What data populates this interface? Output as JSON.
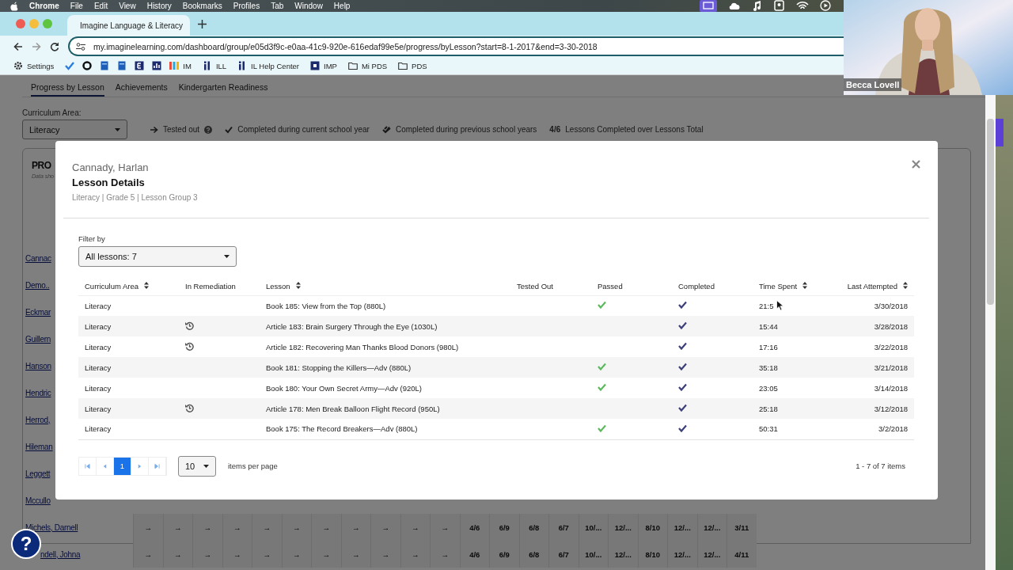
{
  "menu_bar": {
    "app": "Chrome",
    "items": [
      "File",
      "Edit",
      "View",
      "History",
      "Bookmarks",
      "Profiles",
      "Tab",
      "Window",
      "Help"
    ],
    "status_icons": [
      {
        "kind": "screen"
      },
      {
        "kind": "cloud"
      },
      {
        "kind": "music"
      },
      {
        "kind": "badge"
      },
      {
        "kind": "signal"
      },
      {
        "kind": "play"
      }
    ]
  },
  "browser": {
    "tab": {
      "title": "Imagine Language & Literacy",
      "selected": true
    },
    "url": "my.imaginelearning.com/dashboard/group/e05d3f9c-e0aa-41c9-920e-616edaf99e5e/progress/byLesson?start=8-1-2017&end=3-30-2018",
    "bookmarks": [
      {
        "kind": "gear",
        "label": "Settings"
      },
      {
        "kind": "check"
      },
      {
        "kind": "ring"
      },
      {
        "kind": "doc"
      },
      {
        "kind": "doc"
      },
      {
        "kind": "ebox"
      },
      {
        "kind": "chart"
      },
      {
        "kind": "bars",
        "label": "IM"
      },
      {
        "kind": "il",
        "label": "ILL"
      },
      {
        "kind": "il",
        "label": "IL Help Center"
      },
      {
        "kind": "square",
        "label": "IMP"
      },
      {
        "kind": "folder",
        "label": "Mi PDS"
      },
      {
        "kind": "folder",
        "label": "PDS"
      }
    ]
  },
  "video": {
    "name": "Becca Lovell"
  },
  "page": {
    "tabs": [
      {
        "label": "Progress by Lesson",
        "selected": true
      },
      {
        "label": "Achievements",
        "selected": false
      },
      {
        "label": "Kindergarten Readiness",
        "selected": false
      }
    ],
    "curriculum": {
      "label": "Curriculum Area:",
      "value": "Literacy"
    },
    "legend": [
      {
        "kind": "arrow",
        "label": "Tested out"
      },
      {
        "kind": "check",
        "label": "Completed during current school year"
      },
      {
        "kind": "double-check",
        "label": "Completed during previous school years"
      },
      {
        "kind": "ratio",
        "key": "4/6",
        "label": "Lessons Completed over Lessons Total"
      }
    ],
    "panel": {
      "title": "PRO",
      "subtitle": "Data sho"
    },
    "students": [
      {
        "name": "Cannac"
      },
      {
        "name": "Demo.."
      },
      {
        "name": "Eckmar"
      },
      {
        "name": "Guillern"
      },
      {
        "name": "Hanson"
      },
      {
        "name": "Hendric"
      },
      {
        "name": "Herrod,"
      },
      {
        "name": "Hileman"
      },
      {
        "name": "Leggett"
      },
      {
        "name": "Mccullo"
      },
      {
        "name": "Michels, Darnell",
        "cells": [
          "→",
          "→",
          "→",
          "→",
          "→",
          "→",
          "→",
          "→",
          "→",
          "→",
          "→",
          "4/6",
          "6/9",
          "6/8",
          "6/7",
          "10/...",
          "12/...",
          "8/10",
          "12/...",
          "12/...",
          "3/11"
        ]
      },
      {
        "name": "ndell, Johna",
        "cells": [
          "→",
          "→",
          "→",
          "→",
          "→",
          "→",
          "→",
          "→",
          "→",
          "→",
          "→",
          "4/6",
          "6/9",
          "6/8",
          "6/7",
          "10/...",
          "12/...",
          "8/10",
          "12/...",
          "12/...",
          "4/11"
        ]
      }
    ]
  },
  "modal": {
    "student": "Cannady, Harlan",
    "title": "Lesson Details",
    "subtitle": "Literacy | Grade 5 | Lesson Group 3",
    "filter": {
      "label": "Filter by",
      "value": "All lessons: 7"
    },
    "columns": [
      {
        "label": "Curriculum Area",
        "sortable": true
      },
      {
        "label": "In Remediation",
        "sortable": false
      },
      {
        "label": "Lesson",
        "sortable": true
      },
      {
        "label": "Tested Out",
        "sortable": false
      },
      {
        "label": "Passed",
        "sortable": false
      },
      {
        "label": "Completed",
        "sortable": false
      },
      {
        "label": "Time Spent",
        "sortable": true
      },
      {
        "label": "Last Attempted",
        "sortable": true
      }
    ],
    "rows": [
      {
        "curriculum_area": "Literacy",
        "in_remediation": false,
        "lesson": "Book 185: View from the Top (880L)",
        "tested_out": false,
        "passed": true,
        "completed": true,
        "time_spent": "21:5",
        "last_attempted": "3/30/2018"
      },
      {
        "curriculum_area": "Literacy",
        "in_remediation": true,
        "lesson": "Article 183: Brain Surgery Through the Eye (1030L)",
        "tested_out": false,
        "passed": false,
        "completed": true,
        "time_spent": "15:44",
        "last_attempted": "3/28/2018"
      },
      {
        "curriculum_area": "Literacy",
        "in_remediation": true,
        "lesson": "Article 182: Recovering Man Thanks Blood Donors (980L)",
        "tested_out": false,
        "passed": false,
        "completed": true,
        "time_spent": "17:16",
        "last_attempted": "3/22/2018"
      },
      {
        "curriculum_area": "Literacy",
        "in_remediation": false,
        "lesson": "Book 181: Stopping the Killers—Adv (880L)",
        "tested_out": false,
        "passed": true,
        "completed": true,
        "time_spent": "35:18",
        "last_attempted": "3/21/2018"
      },
      {
        "curriculum_area": "Literacy",
        "in_remediation": false,
        "lesson": "Book 180: Your Own Secret Army—Adv (920L)",
        "tested_out": false,
        "passed": true,
        "completed": true,
        "time_spent": "23:05",
        "last_attempted": "3/14/2018"
      },
      {
        "curriculum_area": "Literacy",
        "in_remediation": true,
        "lesson": "Article 178: Men Break Balloon Flight Record (950L)",
        "tested_out": false,
        "passed": false,
        "completed": true,
        "time_spent": "25:18",
        "last_attempted": "3/12/2018"
      },
      {
        "curriculum_area": "Literacy",
        "in_remediation": false,
        "lesson": "Book 175: The Record Breakers—Adv (880L)",
        "tested_out": false,
        "passed": true,
        "completed": true,
        "time_spent": "50:31",
        "last_attempted": "3/2/2018"
      }
    ],
    "pagination": {
      "pages": [
        {
          "label": "1",
          "selected": true
        }
      ],
      "page_size": "10",
      "page_size_label": "items per page",
      "summary": "1 - 7 of 7 items"
    }
  },
  "help_button": {
    "label": "?"
  }
}
